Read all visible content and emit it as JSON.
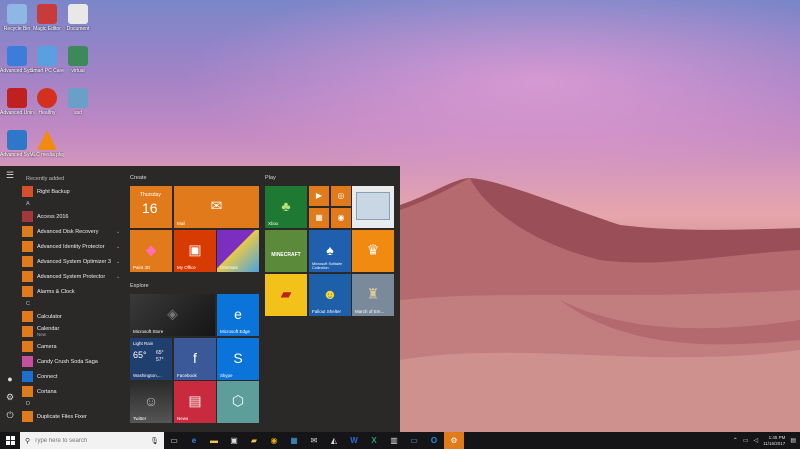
{
  "desktop": {
    "icons": [
      {
        "label": "Recycle Bin",
        "color": "#8fb7e6"
      },
      {
        "label": "Magic Editor",
        "color": "#c93a3a"
      },
      {
        "label": "Document",
        "color": "#e8e8e8"
      },
      {
        "label": "Advanced SystemCare",
        "color": "#3b7dd8"
      },
      {
        "label": "Smart PC Care",
        "color": "#5aa0e0"
      },
      {
        "label": "virtual",
        "color": "#3c8a5c"
      },
      {
        "label": "Advanced Uninstaller",
        "color": "#c02020"
      },
      {
        "label": "Healthy",
        "color": "#d33020"
      },
      {
        "label": "ssd",
        "color": "#6aa0c8"
      },
      {
        "label": "Advanced System...",
        "color": "#2d78c8"
      },
      {
        "label": "VLC media player",
        "color": "#f08a10"
      }
    ]
  },
  "start_menu": {
    "rail": {
      "hamburger": "☰",
      "user": "●",
      "settings": "⚙",
      "power": "⏻"
    },
    "app_list": [
      {
        "type": "section",
        "text": "Recently added"
      },
      {
        "type": "app",
        "name": "Right Backup",
        "color": "#d44f2a"
      },
      {
        "type": "section",
        "text": "A"
      },
      {
        "type": "app",
        "name": "Access 2016",
        "color": "#a4373a"
      },
      {
        "type": "app",
        "name": "Advanced Disk Recovery",
        "color": "#e07a1a",
        "chev": "⌄"
      },
      {
        "type": "app",
        "name": "Advanced Identity Protector",
        "color": "#e07a1a",
        "chev": "⌄"
      },
      {
        "type": "app",
        "name": "Advanced System Optimizer 3",
        "color": "#e07a1a",
        "chev": "⌄"
      },
      {
        "type": "app",
        "name": "Advanced System Protector",
        "color": "#e07a1a",
        "chev": "⌄"
      },
      {
        "type": "app",
        "name": "Alarms & Clock",
        "color": "#e07a1a"
      },
      {
        "type": "section",
        "text": "C"
      },
      {
        "type": "app",
        "name": "Calculator",
        "color": "#e07a1a"
      },
      {
        "type": "app",
        "name": "Calendar",
        "sub": "New",
        "color": "#e07a1a"
      },
      {
        "type": "app",
        "name": "Camera",
        "color": "#e07a1a"
      },
      {
        "type": "app",
        "name": "Candy Crush Soda Saga",
        "color": "#c64fa0"
      },
      {
        "type": "app",
        "name": "Connect",
        "color": "#1d6fcf"
      },
      {
        "type": "app",
        "name": "Cortana",
        "color": "#e07a1a"
      },
      {
        "type": "section",
        "text": "D"
      },
      {
        "type": "app",
        "name": "Duplicate Files Fixer",
        "color": "#e07a1a"
      }
    ],
    "groups": {
      "create": "Create",
      "explore": "Explore",
      "play": "Play"
    },
    "tiles": {
      "calendar": {
        "day": "16",
        "weekday": "Thursday"
      },
      "mail": {
        "label": "Mail"
      },
      "paint3d": {
        "label": "Paint 3D"
      },
      "myoffice": {
        "label": "My Office"
      },
      "onenote": {
        "label": "OneNote"
      },
      "store": {
        "label": "Microsoft Store"
      },
      "edge": {
        "label": "Microsoft Edge"
      },
      "weather": {
        "condition": "Light Rain",
        "temp": "65°",
        "hi": "65°",
        "lo": "57°",
        "city": "Washington,..."
      },
      "facebook": {
        "label": "Facebook"
      },
      "skype": {
        "label": "Skype"
      },
      "twitter": {
        "label": "Twitter"
      },
      "news": {
        "label": "News"
      },
      "xbox": {
        "label": "Xbox"
      },
      "minecraft": {
        "label": "MINECRAFT"
      },
      "solitaire": {
        "label": "Microsoft Solitaire Collection"
      },
      "fallout": {
        "label": "Fallout Shelter"
      },
      "march": {
        "label": "March of Em..."
      }
    }
  },
  "taskbar": {
    "search_placeholder": "Type here to search",
    "clock_time": "1:45 PM",
    "clock_date": "11/16/2017"
  }
}
